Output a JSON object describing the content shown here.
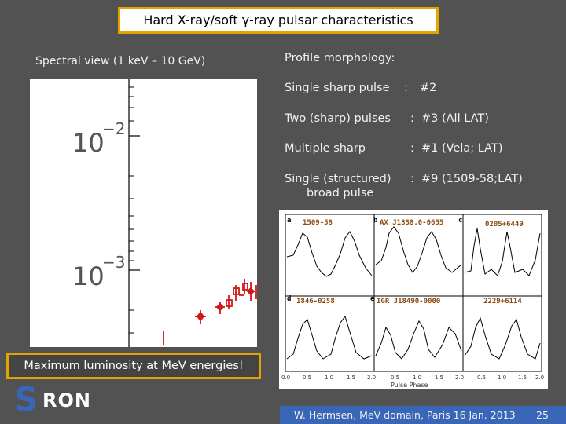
{
  "slide": {
    "title": "Hard X-ray/soft γ-ray pulsar characteristics",
    "spectral_label": "Spectral view (1 keV – 10 GeV)",
    "luminosity_note": "Maximum luminosity at MeV energies!",
    "footer": "W. Hermsen, MeV domain, Paris 16 Jan. 2013",
    "page_number": "25"
  },
  "logo": {
    "s": "S",
    "rest": "RON"
  },
  "spectrum": {
    "ytick_upper_base": "10",
    "ytick_upper_exp": "−2",
    "ytick_lower_base": "10",
    "ytick_lower_exp": "−3"
  },
  "morphology": {
    "heading": "Profile morphology:",
    "rows": [
      {
        "label": "Single sharp pulse",
        "sep": ":",
        "value": "#2",
        "sub": ""
      },
      {
        "label": "Two (sharp) pulses",
        "sep": ":",
        "value": "#3 (All LAT)",
        "sub": ""
      },
      {
        "label": "Multiple sharp",
        "sep": ":",
        "value": "#1 (Vela; LAT)",
        "sub": ""
      },
      {
        "label": "Single (structured)",
        "sep": ":",
        "value": "#9 (1509-58;LAT)",
        "sub": "broad pulse"
      }
    ]
  },
  "profiles": {
    "panels": [
      {
        "letter": "a",
        "name": "1509-58"
      },
      {
        "letter": "b",
        "name": "AX J1838.0-0655"
      },
      {
        "letter": "c",
        "name": "0205+6449"
      },
      {
        "letter": "d",
        "name": "1846-0258"
      },
      {
        "letter": "e",
        "name": "IGR J18490-0000"
      },
      {
        "letter": "f",
        "name": "2229+6114"
      }
    ],
    "xticks": [
      "0.0",
      "0.5",
      "1.0",
      "1.5",
      "2.0",
      "0.5",
      "1.0",
      "1.5",
      "2.0",
      "0.5",
      "1.0",
      "1.5",
      "2.0"
    ],
    "xlabel": "Pulse Phase"
  }
}
